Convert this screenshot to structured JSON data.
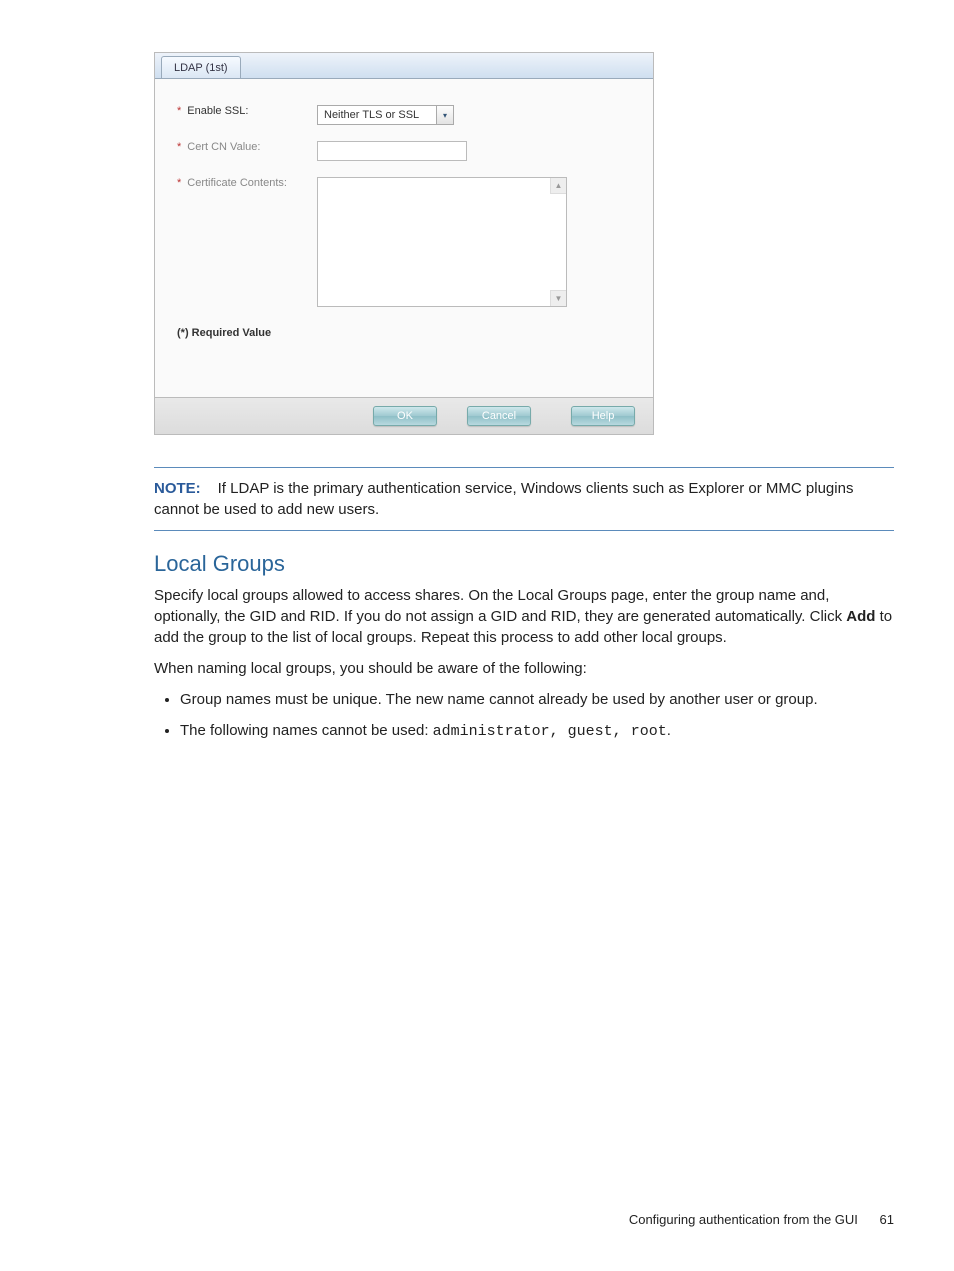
{
  "dialog": {
    "tab_label": "LDAP (1st)",
    "enable_ssl_label": "Enable SSL:",
    "enable_ssl_value": "Neither TLS or SSL",
    "cert_cn_label": "Cert CN Value:",
    "cert_contents_label": "Certificate Contents:",
    "required_note": "(*) Required Value",
    "buttons": {
      "ok": "OK",
      "cancel": "Cancel",
      "help": "Help"
    }
  },
  "note": {
    "label": "NOTE:",
    "text": "If LDAP is the primary authentication service, Windows clients such as Explorer or MMC plugins cannot be used to add new users."
  },
  "section": {
    "heading": "Local Groups",
    "para1a": "Specify local groups allowed to access shares. On the Local Groups page, enter the group name and, optionally, the GID and RID. If you do not assign a GID and RID, they are generated automatically. Click ",
    "para1_bold": "Add",
    "para1b": " to add the group to the list of local groups. Repeat this process to add other local groups.",
    "para2": "When naming local groups, you should be aware of the following:",
    "bullet1": "Group names must be unique. The new name cannot already be used by another user or group.",
    "bullet2a": "The following names cannot be used: ",
    "bullet2_mono": "administrator, guest, root",
    "bullet2b": "."
  },
  "footer": {
    "text": "Configuring authentication from the GUI",
    "page": "61"
  }
}
